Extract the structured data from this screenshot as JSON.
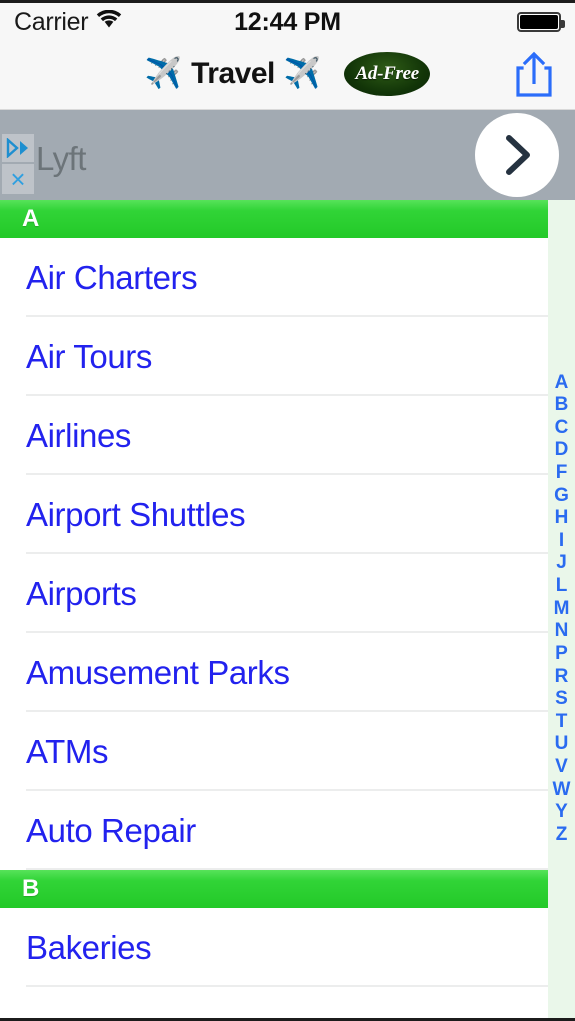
{
  "status_bar": {
    "carrier": "Carrier",
    "wifi_icon": "wifi-icon",
    "time": "12:44 PM",
    "battery_icon": "battery-full-icon"
  },
  "nav_bar": {
    "left_plane_icon": "✈️",
    "title": "Travel",
    "right_plane_icon": "✈️",
    "ad_free_label": "Ad-Free",
    "share_icon": "share-icon"
  },
  "ad_banner": {
    "advertiser": "Lyft",
    "ad_choices_icon": "adchoices-icon",
    "close_icon": "×",
    "next_icon": "chevron-right-icon",
    "background_color": "#a2aab2"
  },
  "list": {
    "sections": [
      {
        "letter": "A",
        "items": [
          "Air Charters",
          "Air Tours",
          "Airlines",
          "Airport Shuttles",
          "Airports",
          "Amusement Parks",
          "ATMs",
          "Auto Repair"
        ]
      },
      {
        "letter": "B",
        "items": [
          "Bakeries"
        ]
      }
    ]
  },
  "index_bar": {
    "letters": [
      "A",
      "B",
      "C",
      "D",
      "F",
      "G",
      "H",
      "I",
      "J",
      "L",
      "M",
      "N",
      "P",
      "R",
      "S",
      "T",
      "U",
      "V",
      "W",
      "Y",
      "Z"
    ]
  },
  "colors": {
    "section_green": "#2ecc31",
    "link_blue": "#2222ee",
    "index_blue": "#2a6bf0",
    "ad_gray": "#a2aab2",
    "badge_yellow": "#f0e400",
    "badge_green": "#173f0a"
  }
}
